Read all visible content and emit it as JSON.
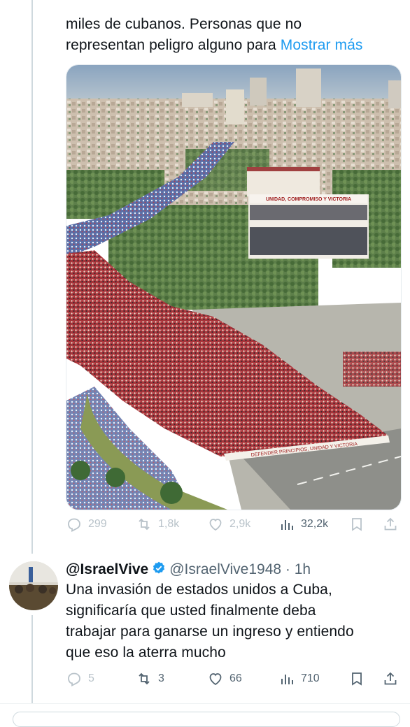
{
  "tweet1": {
    "text_line1": "miles de cubanos. Personas que no",
    "text_line2": "representan peligro alguno para",
    "show_more": "Mostrar más",
    "image_banner": "UNIDAD, COMPROMISO Y VICTORIA",
    "image_march_banner": "DEFENDER PRINCIPIOS, UNIDAD Y VICTORIA",
    "stats": {
      "replies": "299",
      "retweets": "1,8k",
      "likes": "2,9k",
      "views": "32,2k"
    }
  },
  "tweet2": {
    "display_name": "@IsraelVive",
    "handle": "@IsraelVive1948",
    "separator": "·",
    "time": "1h",
    "text_lines": [
      "Una invasión de estados unidos a Cuba,",
      "significaría que usted finalmente deba",
      "trabajar para ganarse un ingreso y entiendo",
      "que eso la aterra mucho"
    ],
    "stats": {
      "replies": "5",
      "retweets": "3",
      "likes": "66",
      "views": "710"
    }
  },
  "icons": {
    "reply": "reply-icon",
    "retweet": "retweet-icon",
    "like": "heart-icon",
    "views": "views-icon",
    "bookmark": "bookmark-icon",
    "share": "share-icon",
    "verified": "verified-badge-icon"
  },
  "colors": {
    "link": "#1d9bf0",
    "text": "#0f1419",
    "muted": "#536471",
    "faded": "#b9c3ca"
  }
}
